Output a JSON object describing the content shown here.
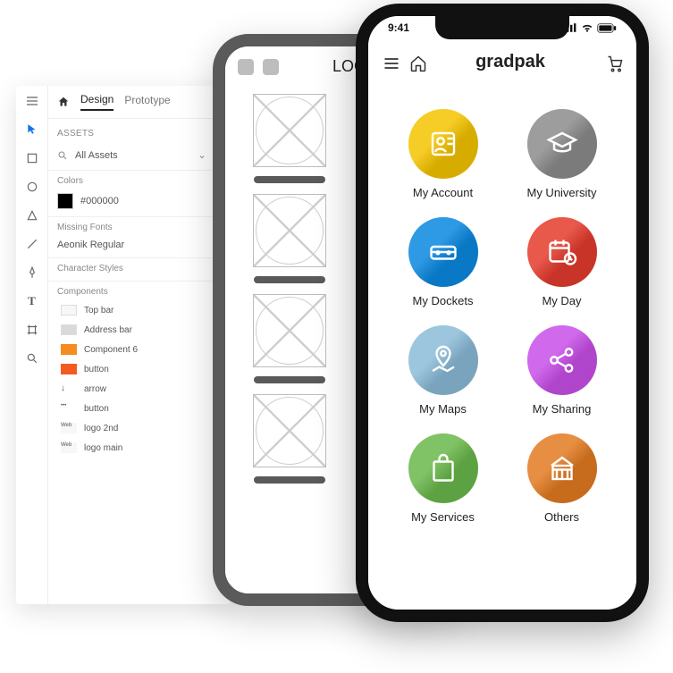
{
  "xd": {
    "tabs": {
      "design": "Design",
      "prototype": "Prototype"
    },
    "assets_head": "ASSETS",
    "assets_filter": "All Assets",
    "colors_head": "Colors",
    "color_hex": "#000000",
    "missing_fonts_head": "Missing Fonts",
    "font_name": "Aeonik Regular",
    "char_styles_head": "Character Styles",
    "components_head": "Components",
    "components": [
      {
        "label": "Top bar"
      },
      {
        "label": "Address bar"
      },
      {
        "label": "Component 6"
      },
      {
        "label": "button"
      },
      {
        "label": "arrow"
      },
      {
        "label": "button"
      },
      {
        "label": "logo 2nd"
      },
      {
        "label": "logo main"
      }
    ]
  },
  "wireframe": {
    "logo": "LOGO"
  },
  "final": {
    "status_time": "9:41",
    "brand": "gradpak",
    "items": [
      {
        "label": "My Account"
      },
      {
        "label": "My University"
      },
      {
        "label": "My Dockets"
      },
      {
        "label": "My Day"
      },
      {
        "label": "My Maps"
      },
      {
        "label": "My Sharing"
      },
      {
        "label": "My Services"
      },
      {
        "label": "Others"
      }
    ]
  }
}
